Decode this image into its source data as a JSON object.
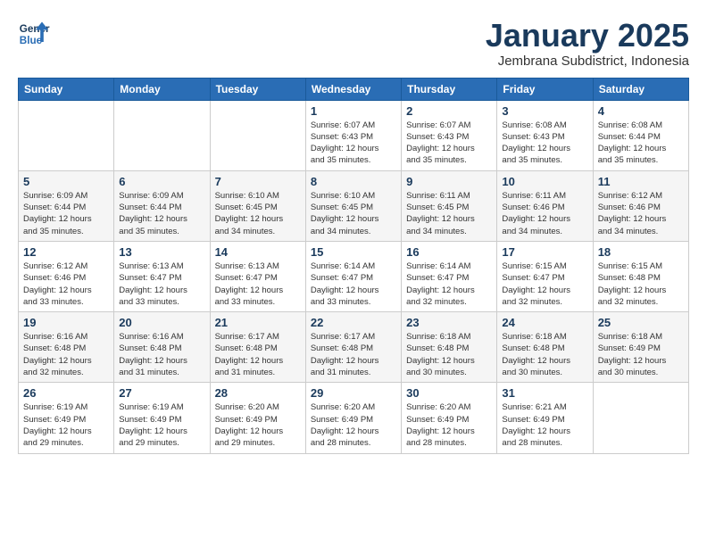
{
  "logo": {
    "line1": "General",
    "line2": "Blue"
  },
  "title": "January 2025",
  "subtitle": "Jembrana Subdistrict, Indonesia",
  "weekdays": [
    "Sunday",
    "Monday",
    "Tuesday",
    "Wednesday",
    "Thursday",
    "Friday",
    "Saturday"
  ],
  "weeks": [
    [
      {
        "day": "",
        "info": ""
      },
      {
        "day": "",
        "info": ""
      },
      {
        "day": "",
        "info": ""
      },
      {
        "day": "1",
        "info": "Sunrise: 6:07 AM\nSunset: 6:43 PM\nDaylight: 12 hours\nand 35 minutes."
      },
      {
        "day": "2",
        "info": "Sunrise: 6:07 AM\nSunset: 6:43 PM\nDaylight: 12 hours\nand 35 minutes."
      },
      {
        "day": "3",
        "info": "Sunrise: 6:08 AM\nSunset: 6:43 PM\nDaylight: 12 hours\nand 35 minutes."
      },
      {
        "day": "4",
        "info": "Sunrise: 6:08 AM\nSunset: 6:44 PM\nDaylight: 12 hours\nand 35 minutes."
      }
    ],
    [
      {
        "day": "5",
        "info": "Sunrise: 6:09 AM\nSunset: 6:44 PM\nDaylight: 12 hours\nand 35 minutes."
      },
      {
        "day": "6",
        "info": "Sunrise: 6:09 AM\nSunset: 6:44 PM\nDaylight: 12 hours\nand 35 minutes."
      },
      {
        "day": "7",
        "info": "Sunrise: 6:10 AM\nSunset: 6:45 PM\nDaylight: 12 hours\nand 34 minutes."
      },
      {
        "day": "8",
        "info": "Sunrise: 6:10 AM\nSunset: 6:45 PM\nDaylight: 12 hours\nand 34 minutes."
      },
      {
        "day": "9",
        "info": "Sunrise: 6:11 AM\nSunset: 6:45 PM\nDaylight: 12 hours\nand 34 minutes."
      },
      {
        "day": "10",
        "info": "Sunrise: 6:11 AM\nSunset: 6:46 PM\nDaylight: 12 hours\nand 34 minutes."
      },
      {
        "day": "11",
        "info": "Sunrise: 6:12 AM\nSunset: 6:46 PM\nDaylight: 12 hours\nand 34 minutes."
      }
    ],
    [
      {
        "day": "12",
        "info": "Sunrise: 6:12 AM\nSunset: 6:46 PM\nDaylight: 12 hours\nand 33 minutes."
      },
      {
        "day": "13",
        "info": "Sunrise: 6:13 AM\nSunset: 6:47 PM\nDaylight: 12 hours\nand 33 minutes."
      },
      {
        "day": "14",
        "info": "Sunrise: 6:13 AM\nSunset: 6:47 PM\nDaylight: 12 hours\nand 33 minutes."
      },
      {
        "day": "15",
        "info": "Sunrise: 6:14 AM\nSunset: 6:47 PM\nDaylight: 12 hours\nand 33 minutes."
      },
      {
        "day": "16",
        "info": "Sunrise: 6:14 AM\nSunset: 6:47 PM\nDaylight: 12 hours\nand 32 minutes."
      },
      {
        "day": "17",
        "info": "Sunrise: 6:15 AM\nSunset: 6:47 PM\nDaylight: 12 hours\nand 32 minutes."
      },
      {
        "day": "18",
        "info": "Sunrise: 6:15 AM\nSunset: 6:48 PM\nDaylight: 12 hours\nand 32 minutes."
      }
    ],
    [
      {
        "day": "19",
        "info": "Sunrise: 6:16 AM\nSunset: 6:48 PM\nDaylight: 12 hours\nand 32 minutes."
      },
      {
        "day": "20",
        "info": "Sunrise: 6:16 AM\nSunset: 6:48 PM\nDaylight: 12 hours\nand 31 minutes."
      },
      {
        "day": "21",
        "info": "Sunrise: 6:17 AM\nSunset: 6:48 PM\nDaylight: 12 hours\nand 31 minutes."
      },
      {
        "day": "22",
        "info": "Sunrise: 6:17 AM\nSunset: 6:48 PM\nDaylight: 12 hours\nand 31 minutes."
      },
      {
        "day": "23",
        "info": "Sunrise: 6:18 AM\nSunset: 6:48 PM\nDaylight: 12 hours\nand 30 minutes."
      },
      {
        "day": "24",
        "info": "Sunrise: 6:18 AM\nSunset: 6:48 PM\nDaylight: 12 hours\nand 30 minutes."
      },
      {
        "day": "25",
        "info": "Sunrise: 6:18 AM\nSunset: 6:49 PM\nDaylight: 12 hours\nand 30 minutes."
      }
    ],
    [
      {
        "day": "26",
        "info": "Sunrise: 6:19 AM\nSunset: 6:49 PM\nDaylight: 12 hours\nand 29 minutes."
      },
      {
        "day": "27",
        "info": "Sunrise: 6:19 AM\nSunset: 6:49 PM\nDaylight: 12 hours\nand 29 minutes."
      },
      {
        "day": "28",
        "info": "Sunrise: 6:20 AM\nSunset: 6:49 PM\nDaylight: 12 hours\nand 29 minutes."
      },
      {
        "day": "29",
        "info": "Sunrise: 6:20 AM\nSunset: 6:49 PM\nDaylight: 12 hours\nand 28 minutes."
      },
      {
        "day": "30",
        "info": "Sunrise: 6:20 AM\nSunset: 6:49 PM\nDaylight: 12 hours\nand 28 minutes."
      },
      {
        "day": "31",
        "info": "Sunrise: 6:21 AM\nSunset: 6:49 PM\nDaylight: 12 hours\nand 28 minutes."
      },
      {
        "day": "",
        "info": ""
      }
    ]
  ]
}
